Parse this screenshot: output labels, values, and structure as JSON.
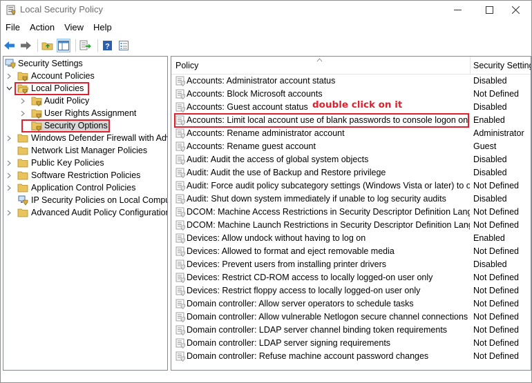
{
  "window": {
    "title": "Local Security Policy"
  },
  "menubar": {
    "items": [
      "File",
      "Action",
      "View",
      "Help"
    ]
  },
  "toolbar": {
    "buttons": [
      "back-icon",
      "forward-icon",
      "up-folder-icon",
      "show-hide-tree-icon",
      "export-list-icon",
      "help-icon",
      "properties-icon"
    ]
  },
  "tree": {
    "root": "Security Settings",
    "items": [
      {
        "label": "Account Policies",
        "level": 1,
        "expanded": false
      },
      {
        "label": "Local Policies",
        "level": 1,
        "expanded": true
      },
      {
        "label": "Audit Policy",
        "level": 2,
        "expanded": false
      },
      {
        "label": "User Rights Assignment",
        "level": 2,
        "expanded": false
      },
      {
        "label": "Security Options",
        "level": 2,
        "selected": true
      },
      {
        "label": "Windows Defender Firewall with Adva",
        "level": 1,
        "expanded": false
      },
      {
        "label": "Network List Manager Policies",
        "level": 1
      },
      {
        "label": "Public Key Policies",
        "level": 1,
        "expanded": false
      },
      {
        "label": "Software Restriction Policies",
        "level": 1,
        "expanded": false
      },
      {
        "label": "Application Control Policies",
        "level": 1,
        "expanded": false
      },
      {
        "label": "IP Security Policies on Local Compute",
        "level": 1
      },
      {
        "label": "Advanced Audit Policy Configuration",
        "level": 1,
        "expanded": false
      }
    ]
  },
  "list": {
    "columns": {
      "policy": "Policy",
      "setting": "Security Setting"
    },
    "annotation": "double click on it",
    "rows": [
      {
        "policy": "Accounts: Administrator account status",
        "setting": "Disabled"
      },
      {
        "policy": "Accounts: Block Microsoft accounts",
        "setting": "Not Defined"
      },
      {
        "policy": "Accounts: Guest account status",
        "setting": "Disabled"
      },
      {
        "policy": "Accounts: Limit local account use of blank passwords to console logon only",
        "setting": "Enabled",
        "highlighted": true
      },
      {
        "policy": "Accounts: Rename administrator account",
        "setting": "Administrator"
      },
      {
        "policy": "Accounts: Rename guest account",
        "setting": "Guest"
      },
      {
        "policy": "Audit: Audit the access of global system objects",
        "setting": "Disabled"
      },
      {
        "policy": "Audit: Audit the use of Backup and Restore privilege",
        "setting": "Disabled"
      },
      {
        "policy": "Audit: Force audit policy subcategory settings (Windows Vista or later) to o...",
        "setting": "Not Defined"
      },
      {
        "policy": "Audit: Shut down system immediately if unable to log security audits",
        "setting": "Disabled"
      },
      {
        "policy": "DCOM: Machine Access Restrictions in Security Descriptor Definition Langu...",
        "setting": "Not Defined"
      },
      {
        "policy": "DCOM: Machine Launch Restrictions in Security Descriptor Definition Langu...",
        "setting": "Not Defined"
      },
      {
        "policy": "Devices: Allow undock without having to log on",
        "setting": "Enabled"
      },
      {
        "policy": "Devices: Allowed to format and eject removable media",
        "setting": "Not Defined"
      },
      {
        "policy": "Devices: Prevent users from installing printer drivers",
        "setting": "Disabled"
      },
      {
        "policy": "Devices: Restrict CD-ROM access to locally logged-on user only",
        "setting": "Not Defined"
      },
      {
        "policy": "Devices: Restrict floppy access to locally logged-on user only",
        "setting": "Not Defined"
      },
      {
        "policy": "Domain controller: Allow server operators to schedule tasks",
        "setting": "Not Defined"
      },
      {
        "policy": "Domain controller: Allow vulnerable Netlogon secure channel connections",
        "setting": "Not Defined"
      },
      {
        "policy": "Domain controller: LDAP server channel binding token requirements",
        "setting": "Not Defined"
      },
      {
        "policy": "Domain controller: LDAP server signing requirements",
        "setting": "Not Defined"
      },
      {
        "policy": "Domain controller: Refuse machine account password changes",
        "setting": "Not Defined"
      }
    ]
  },
  "colors": {
    "annotation_red": "#e0202f",
    "selection_grey": "#d9d9d9"
  }
}
